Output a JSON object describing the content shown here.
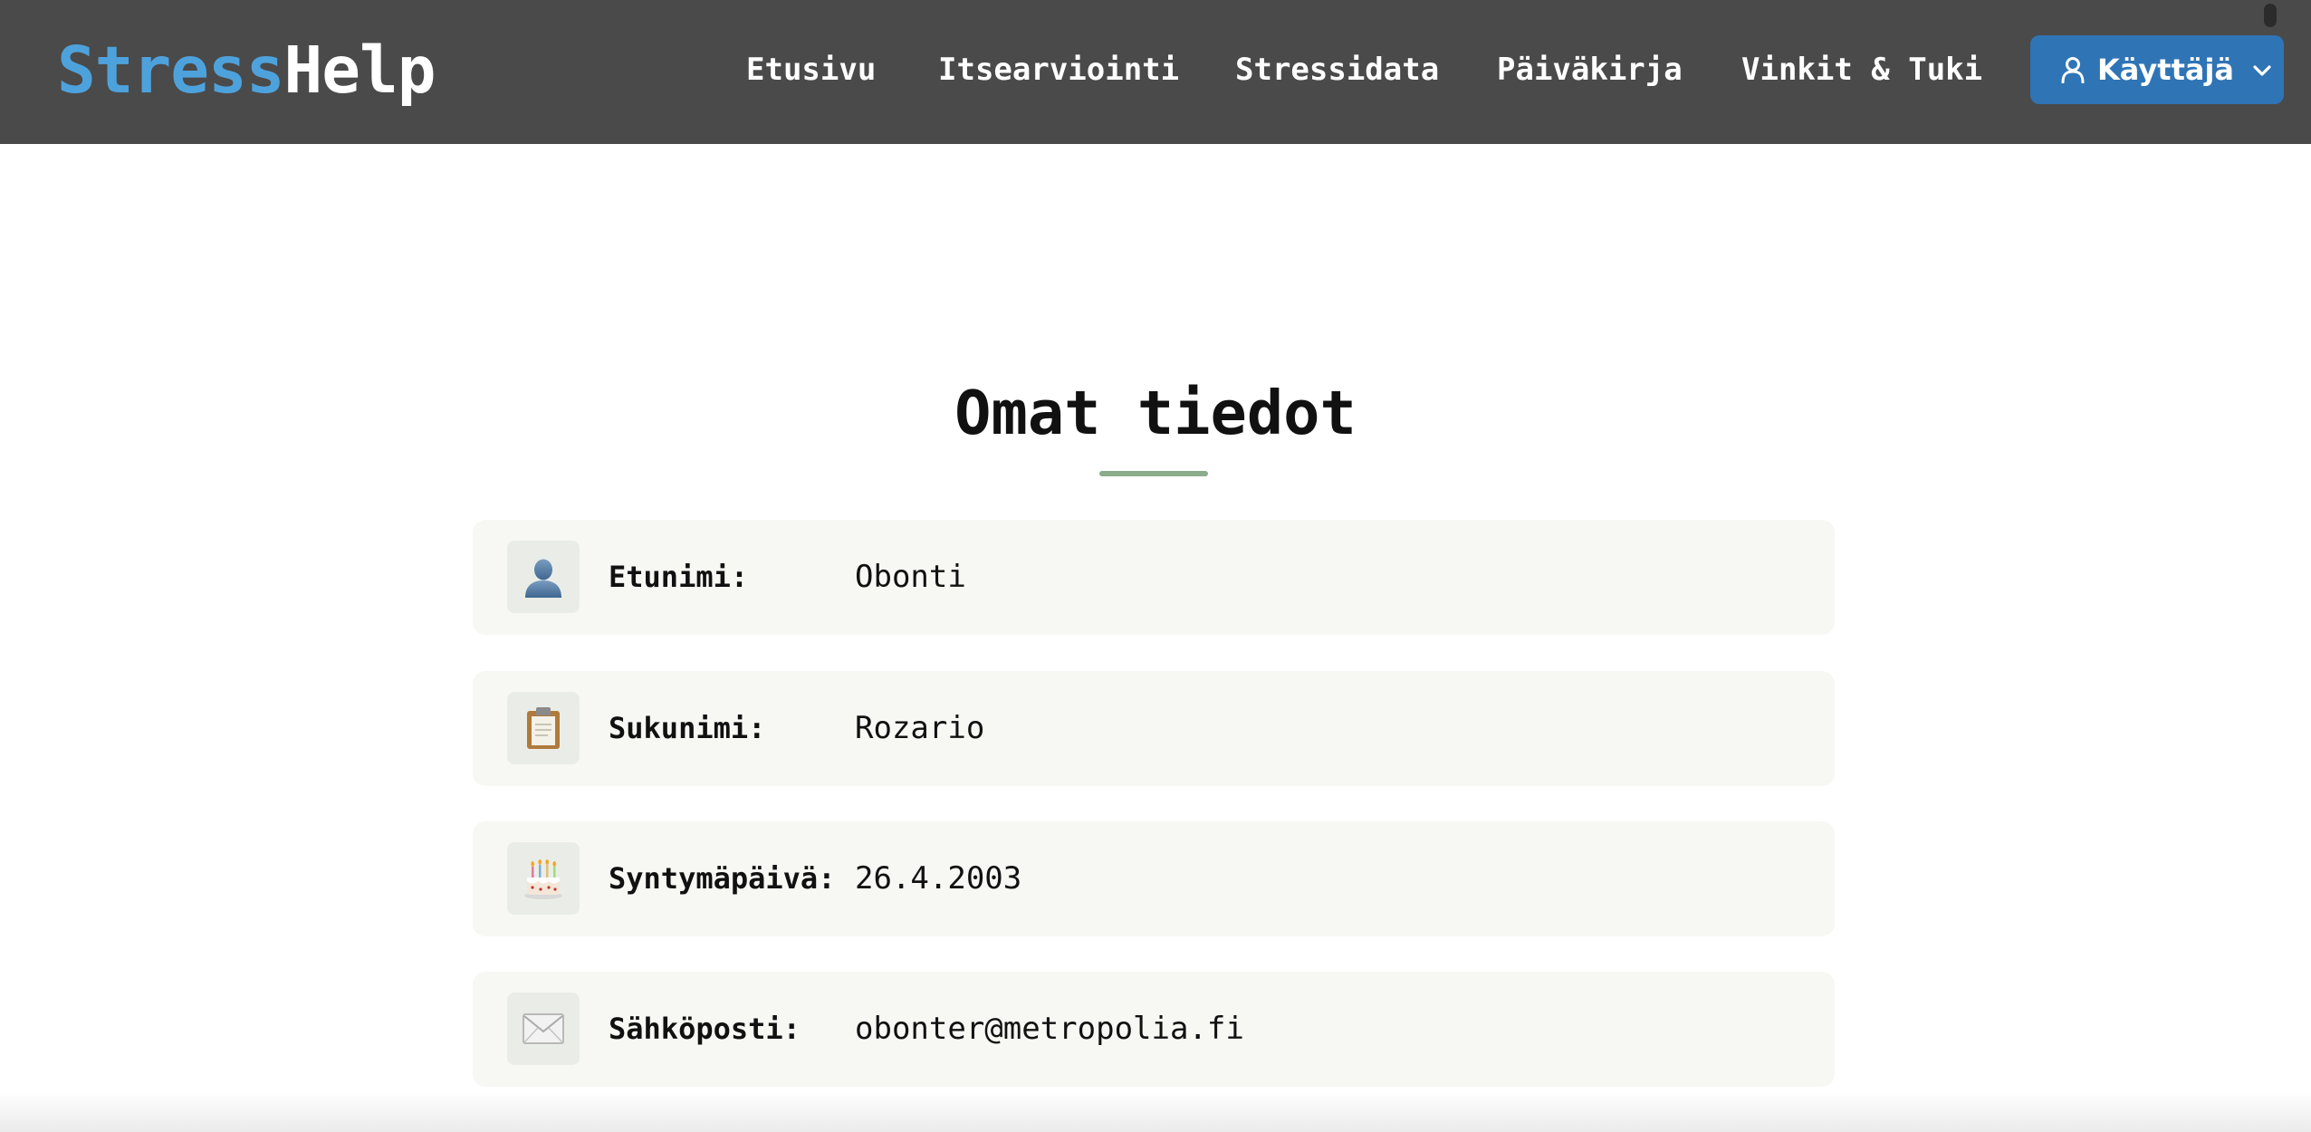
{
  "app": {
    "logo_part1": "Stress",
    "logo_part2": "Help"
  },
  "nav": {
    "items": [
      {
        "label": "Etusivu"
      },
      {
        "label": "Itsearviointi"
      },
      {
        "label": "Stressidata"
      },
      {
        "label": "Päiväkirja"
      },
      {
        "label": "Vinkit & Tuki"
      }
    ],
    "user_menu": {
      "label": "Käyttäjä",
      "icon": "user-icon",
      "caret_icon": "chevron-down-icon"
    }
  },
  "main": {
    "title": "Omat tiedot",
    "fields": [
      {
        "icon": "person-silhouette-icon",
        "label": "Etunimi:",
        "value": "Obonti"
      },
      {
        "icon": "clipboard-icon",
        "label": "Sukunimi:",
        "value": "Rozario"
      },
      {
        "icon": "birthday-cake-icon",
        "label": "Syntymäpäivä:",
        "value": "26.4.2003"
      },
      {
        "icon": "envelope-icon",
        "label": "Sähköposti:",
        "value": "obonter@metropolia.fi"
      }
    ]
  },
  "colors": {
    "navbar_bg": "#4a4a4a",
    "logo_accent": "#4ea2dc",
    "user_button_bg": "#2f74b5",
    "title_underline": "#8aac8a",
    "card_bg": "#f7f8f4"
  }
}
